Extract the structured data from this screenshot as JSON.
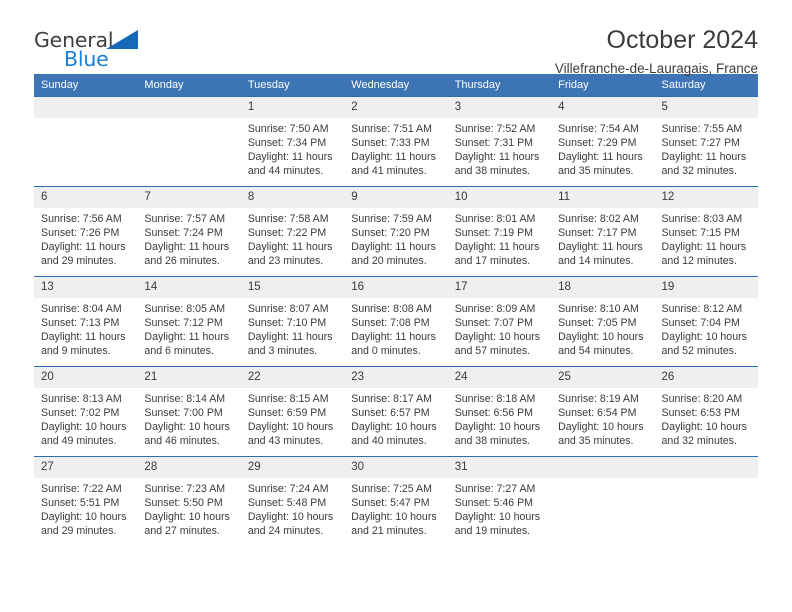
{
  "brand": {
    "name_part1": "General",
    "name_part2": "Blue",
    "color_dark": "#3f3f3f",
    "color_blue": "#1a7fd4",
    "triangle_color": "#1668b8"
  },
  "header": {
    "title": "October 2024",
    "subtitle": "Villefranche-de-Lauragais, France"
  },
  "theme": {
    "header_blue": "#3c74b4",
    "grid_line": "#2f6bb0",
    "daynum_background": "#efefef",
    "text": "#3b3b3b"
  },
  "weekday_headers": [
    "Sunday",
    "Monday",
    "Tuesday",
    "Wednesday",
    "Thursday",
    "Friday",
    "Saturday"
  ],
  "weeks": [
    [
      {
        "day": "",
        "blank": true,
        "sunrise": "",
        "sunset": "",
        "daylight_line1": "",
        "daylight_line2": ""
      },
      {
        "day": "",
        "blank": true,
        "sunrise": "",
        "sunset": "",
        "daylight_line1": "",
        "daylight_line2": ""
      },
      {
        "day": "1",
        "blank": false,
        "sunrise": "Sunrise: 7:50 AM",
        "sunset": "Sunset: 7:34 PM",
        "daylight_line1": "Daylight: 11 hours",
        "daylight_line2": "and 44 minutes."
      },
      {
        "day": "2",
        "blank": false,
        "sunrise": "Sunrise: 7:51 AM",
        "sunset": "Sunset: 7:33 PM",
        "daylight_line1": "Daylight: 11 hours",
        "daylight_line2": "and 41 minutes."
      },
      {
        "day": "3",
        "blank": false,
        "sunrise": "Sunrise: 7:52 AM",
        "sunset": "Sunset: 7:31 PM",
        "daylight_line1": "Daylight: 11 hours",
        "daylight_line2": "and 38 minutes."
      },
      {
        "day": "4",
        "blank": false,
        "sunrise": "Sunrise: 7:54 AM",
        "sunset": "Sunset: 7:29 PM",
        "daylight_line1": "Daylight: 11 hours",
        "daylight_line2": "and 35 minutes."
      },
      {
        "day": "5",
        "blank": false,
        "sunrise": "Sunrise: 7:55 AM",
        "sunset": "Sunset: 7:27 PM",
        "daylight_line1": "Daylight: 11 hours",
        "daylight_line2": "and 32 minutes."
      }
    ],
    [
      {
        "day": "6",
        "blank": false,
        "sunrise": "Sunrise: 7:56 AM",
        "sunset": "Sunset: 7:26 PM",
        "daylight_line1": "Daylight: 11 hours",
        "daylight_line2": "and 29 minutes."
      },
      {
        "day": "7",
        "blank": false,
        "sunrise": "Sunrise: 7:57 AM",
        "sunset": "Sunset: 7:24 PM",
        "daylight_line1": "Daylight: 11 hours",
        "daylight_line2": "and 26 minutes."
      },
      {
        "day": "8",
        "blank": false,
        "sunrise": "Sunrise: 7:58 AM",
        "sunset": "Sunset: 7:22 PM",
        "daylight_line1": "Daylight: 11 hours",
        "daylight_line2": "and 23 minutes."
      },
      {
        "day": "9",
        "blank": false,
        "sunrise": "Sunrise: 7:59 AM",
        "sunset": "Sunset: 7:20 PM",
        "daylight_line1": "Daylight: 11 hours",
        "daylight_line2": "and 20 minutes."
      },
      {
        "day": "10",
        "blank": false,
        "sunrise": "Sunrise: 8:01 AM",
        "sunset": "Sunset: 7:19 PM",
        "daylight_line1": "Daylight: 11 hours",
        "daylight_line2": "and 17 minutes."
      },
      {
        "day": "11",
        "blank": false,
        "sunrise": "Sunrise: 8:02 AM",
        "sunset": "Sunset: 7:17 PM",
        "daylight_line1": "Daylight: 11 hours",
        "daylight_line2": "and 14 minutes."
      },
      {
        "day": "12",
        "blank": false,
        "sunrise": "Sunrise: 8:03 AM",
        "sunset": "Sunset: 7:15 PM",
        "daylight_line1": "Daylight: 11 hours",
        "daylight_line2": "and 12 minutes."
      }
    ],
    [
      {
        "day": "13",
        "blank": false,
        "sunrise": "Sunrise: 8:04 AM",
        "sunset": "Sunset: 7:13 PM",
        "daylight_line1": "Daylight: 11 hours",
        "daylight_line2": "and 9 minutes."
      },
      {
        "day": "14",
        "blank": false,
        "sunrise": "Sunrise: 8:05 AM",
        "sunset": "Sunset: 7:12 PM",
        "daylight_line1": "Daylight: 11 hours",
        "daylight_line2": "and 6 minutes."
      },
      {
        "day": "15",
        "blank": false,
        "sunrise": "Sunrise: 8:07 AM",
        "sunset": "Sunset: 7:10 PM",
        "daylight_line1": "Daylight: 11 hours",
        "daylight_line2": "and 3 minutes."
      },
      {
        "day": "16",
        "blank": false,
        "sunrise": "Sunrise: 8:08 AM",
        "sunset": "Sunset: 7:08 PM",
        "daylight_line1": "Daylight: 11 hours",
        "daylight_line2": "and 0 minutes."
      },
      {
        "day": "17",
        "blank": false,
        "sunrise": "Sunrise: 8:09 AM",
        "sunset": "Sunset: 7:07 PM",
        "daylight_line1": "Daylight: 10 hours",
        "daylight_line2": "and 57 minutes."
      },
      {
        "day": "18",
        "blank": false,
        "sunrise": "Sunrise: 8:10 AM",
        "sunset": "Sunset: 7:05 PM",
        "daylight_line1": "Daylight: 10 hours",
        "daylight_line2": "and 54 minutes."
      },
      {
        "day": "19",
        "blank": false,
        "sunrise": "Sunrise: 8:12 AM",
        "sunset": "Sunset: 7:04 PM",
        "daylight_line1": "Daylight: 10 hours",
        "daylight_line2": "and 52 minutes."
      }
    ],
    [
      {
        "day": "20",
        "blank": false,
        "sunrise": "Sunrise: 8:13 AM",
        "sunset": "Sunset: 7:02 PM",
        "daylight_line1": "Daylight: 10 hours",
        "daylight_line2": "and 49 minutes."
      },
      {
        "day": "21",
        "blank": false,
        "sunrise": "Sunrise: 8:14 AM",
        "sunset": "Sunset: 7:00 PM",
        "daylight_line1": "Daylight: 10 hours",
        "daylight_line2": "and 46 minutes."
      },
      {
        "day": "22",
        "blank": false,
        "sunrise": "Sunrise: 8:15 AM",
        "sunset": "Sunset: 6:59 PM",
        "daylight_line1": "Daylight: 10 hours",
        "daylight_line2": "and 43 minutes."
      },
      {
        "day": "23",
        "blank": false,
        "sunrise": "Sunrise: 8:17 AM",
        "sunset": "Sunset: 6:57 PM",
        "daylight_line1": "Daylight: 10 hours",
        "daylight_line2": "and 40 minutes."
      },
      {
        "day": "24",
        "blank": false,
        "sunrise": "Sunrise: 8:18 AM",
        "sunset": "Sunset: 6:56 PM",
        "daylight_line1": "Daylight: 10 hours",
        "daylight_line2": "and 38 minutes."
      },
      {
        "day": "25",
        "blank": false,
        "sunrise": "Sunrise: 8:19 AM",
        "sunset": "Sunset: 6:54 PM",
        "daylight_line1": "Daylight: 10 hours",
        "daylight_line2": "and 35 minutes."
      },
      {
        "day": "26",
        "blank": false,
        "sunrise": "Sunrise: 8:20 AM",
        "sunset": "Sunset: 6:53 PM",
        "daylight_line1": "Daylight: 10 hours",
        "daylight_line2": "and 32 minutes."
      }
    ],
    [
      {
        "day": "27",
        "blank": false,
        "sunrise": "Sunrise: 7:22 AM",
        "sunset": "Sunset: 5:51 PM",
        "daylight_line1": "Daylight: 10 hours",
        "daylight_line2": "and 29 minutes."
      },
      {
        "day": "28",
        "blank": false,
        "sunrise": "Sunrise: 7:23 AM",
        "sunset": "Sunset: 5:50 PM",
        "daylight_line1": "Daylight: 10 hours",
        "daylight_line2": "and 27 minutes."
      },
      {
        "day": "29",
        "blank": false,
        "sunrise": "Sunrise: 7:24 AM",
        "sunset": "Sunset: 5:48 PM",
        "daylight_line1": "Daylight: 10 hours",
        "daylight_line2": "and 24 minutes."
      },
      {
        "day": "30",
        "blank": false,
        "sunrise": "Sunrise: 7:25 AM",
        "sunset": "Sunset: 5:47 PM",
        "daylight_line1": "Daylight: 10 hours",
        "daylight_line2": "and 21 minutes."
      },
      {
        "day": "31",
        "blank": false,
        "sunrise": "Sunrise: 7:27 AM",
        "sunset": "Sunset: 5:46 PM",
        "daylight_line1": "Daylight: 10 hours",
        "daylight_line2": "and 19 minutes."
      },
      {
        "day": "",
        "blank": true,
        "sunrise": "",
        "sunset": "",
        "daylight_line1": "",
        "daylight_line2": ""
      },
      {
        "day": "",
        "blank": true,
        "sunrise": "",
        "sunset": "",
        "daylight_line1": "",
        "daylight_line2": ""
      }
    ]
  ]
}
